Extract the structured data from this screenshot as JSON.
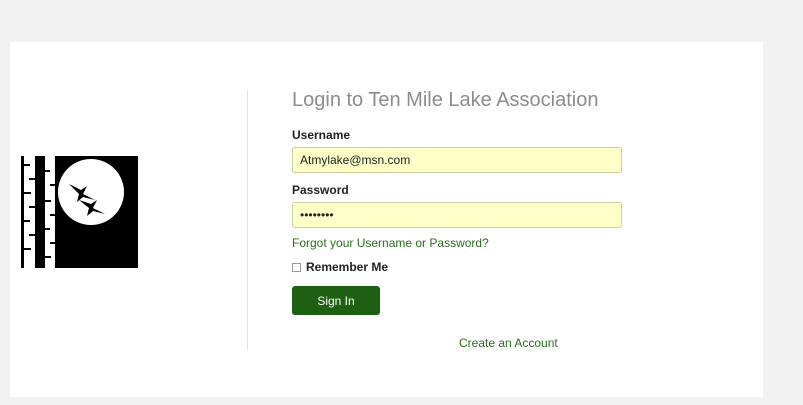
{
  "login": {
    "title": "Login to Ten Mile Lake Association",
    "username_label": "Username",
    "username_value": "Atmylake@msn.com",
    "password_label": "Password",
    "password_value": "••••••••",
    "forgot_link": "Forgot your Username or Password?",
    "remember_label": "Remember Me",
    "signin_label": "Sign In",
    "create_account_link": "Create an Account"
  },
  "colors": {
    "accent": "#1e6012",
    "link": "#2a6e1e",
    "input_bg": "#ffffc8",
    "title": "#8c8c8c"
  },
  "icons": {
    "logo": "birch-trees-moon-loons-logo"
  }
}
